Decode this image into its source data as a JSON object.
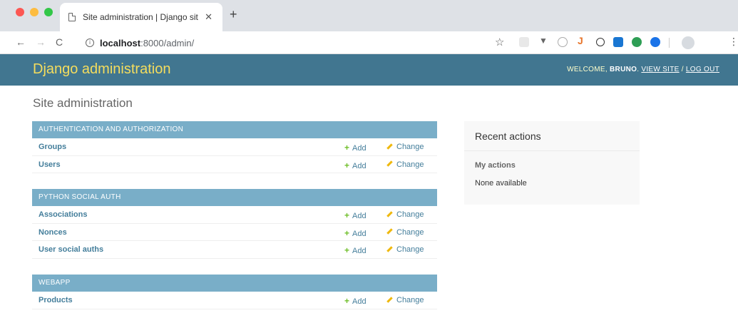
{
  "browser": {
    "tab_title": "Site administration | Django sit",
    "tab_close": "✕",
    "new_tab": "+",
    "url_host": "localhost",
    "url_rest": ":8000/admin/"
  },
  "header": {
    "branding": "Django administration",
    "welcome": "WELCOME, ",
    "username": "BRUNO",
    "view_site": "VIEW SITE",
    "separator": " / ",
    "log_out": "LOG OUT"
  },
  "page_title": "Site administration",
  "modules": [
    {
      "caption": "AUTHENTICATION AND AUTHORIZATION",
      "models": [
        "Groups",
        "Users"
      ]
    },
    {
      "caption": "PYTHON SOCIAL AUTH",
      "models": [
        "Associations",
        "Nonces",
        "User social auths"
      ]
    },
    {
      "caption": "WEBAPP",
      "models": [
        "Products"
      ]
    }
  ],
  "actions": {
    "add": "Add",
    "change": "Change"
  },
  "recent": {
    "title": "Recent actions",
    "my_actions": "My actions",
    "none": "None available"
  },
  "colors": {
    "header_bg": "#417690",
    "branding": "#f5dd5d",
    "caption_bg": "#79aec8",
    "link": "#447e9b",
    "add_green": "#70bf2b",
    "change_yellow": "#efb80b"
  }
}
